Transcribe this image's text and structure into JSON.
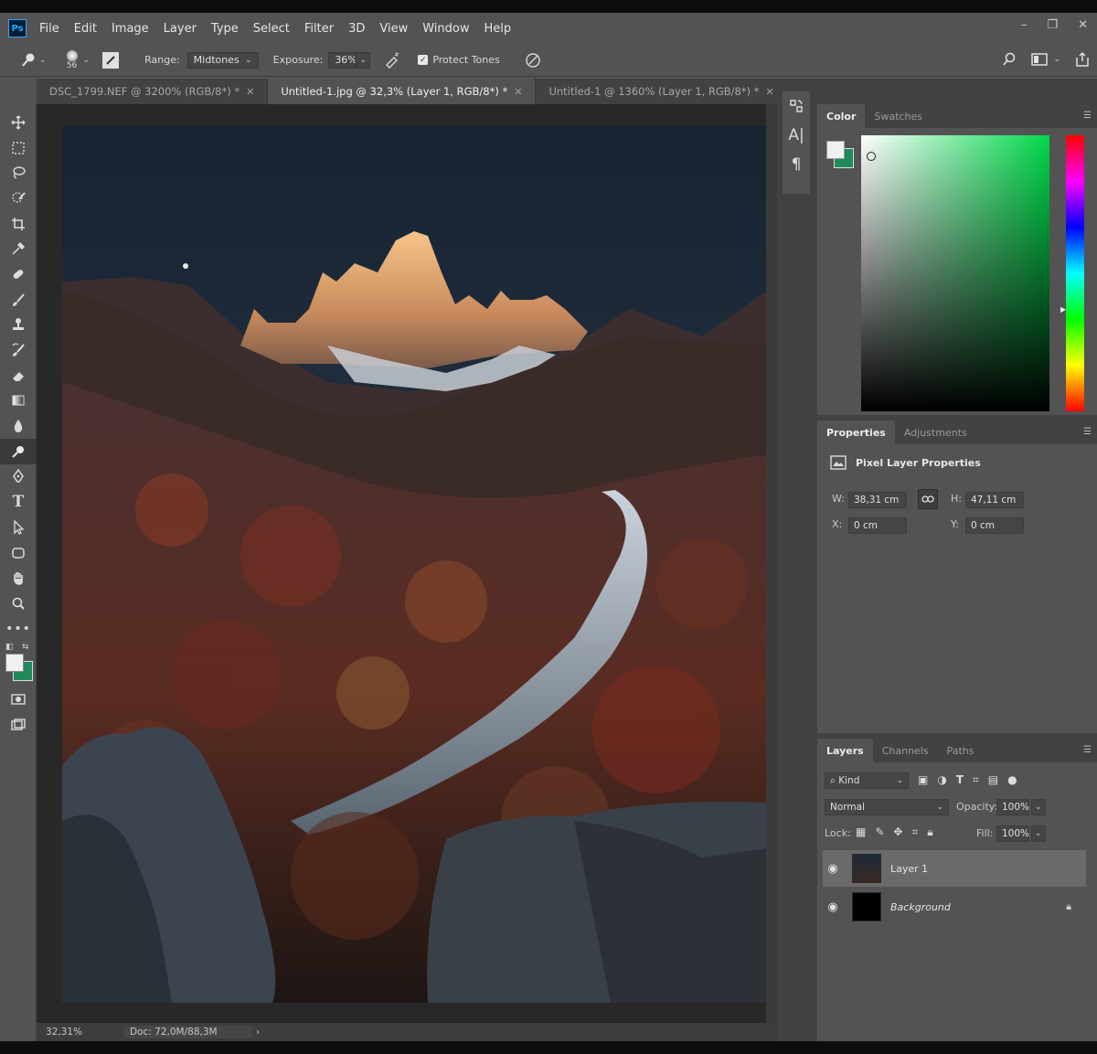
{
  "app": {
    "logo": "Ps"
  },
  "menu": [
    "File",
    "Edit",
    "Image",
    "Layer",
    "Type",
    "Select",
    "Filter",
    "3D",
    "View",
    "Window",
    "Help"
  ],
  "window_controls": {
    "minimize": "–",
    "restore": "❐",
    "close": "✕"
  },
  "options": {
    "brush_size": "56",
    "range_label": "Range:",
    "range_value": "Midtones",
    "exposure_label": "Exposure:",
    "exposure_value": "36%",
    "protect_tones_label": "Protect Tones",
    "protect_tones_checked": true
  },
  "tabs": [
    {
      "label": "DSC_1799.NEF @ 3200% (RGB/8*) *",
      "active": false
    },
    {
      "label": "Untitled-1.jpg @ 32,3% (Layer 1, RGB/8*) *",
      "active": true
    },
    {
      "label": "Untitled-1 @ 1360% (Layer 1, RGB/8*) *",
      "active": false
    }
  ],
  "tools": [
    "move-icon",
    "marquee-icon",
    "lasso-icon",
    "quick-select-icon",
    "crop-icon",
    "eyedropper-icon",
    "healing-icon",
    "brush-icon",
    "stamp-icon",
    "history-brush-icon",
    "eraser-icon",
    "gradient-icon",
    "blur-icon",
    "dodge-icon",
    "pen-icon",
    "type-icon",
    "path-select-icon",
    "shape-icon",
    "hand-icon",
    "zoom-icon",
    "more-icon"
  ],
  "status": {
    "zoom": "32,31%",
    "doc": "Doc: 72,0M/88,3M"
  },
  "color_panel": {
    "tabs": [
      "Color",
      "Swatches"
    ],
    "foreground": "#f0f0f0",
    "background": "#1e8a5a",
    "hue": "#00d84a"
  },
  "properties_panel": {
    "tabs": [
      "Properties",
      "Adjustments"
    ],
    "title": "Pixel Layer Properties",
    "w_label": "W:",
    "w_value": "38,31 cm",
    "h_label": "H:",
    "h_value": "47,11 cm",
    "x_label": "X:",
    "x_value": "0 cm",
    "y_label": "Y:",
    "y_value": "0 cm"
  },
  "layers_panel": {
    "tabs": [
      "Layers",
      "Channels",
      "Paths"
    ],
    "kind_label": "Kind",
    "blend_mode": "Normal",
    "opacity_label": "Opacity:",
    "opacity_value": "100%",
    "lock_label": "Lock:",
    "fill_label": "Fill:",
    "fill_value": "100%",
    "layers": [
      {
        "name": "Layer 1",
        "selected": true
      },
      {
        "name": "Background",
        "selected": false,
        "locked": true
      }
    ]
  }
}
